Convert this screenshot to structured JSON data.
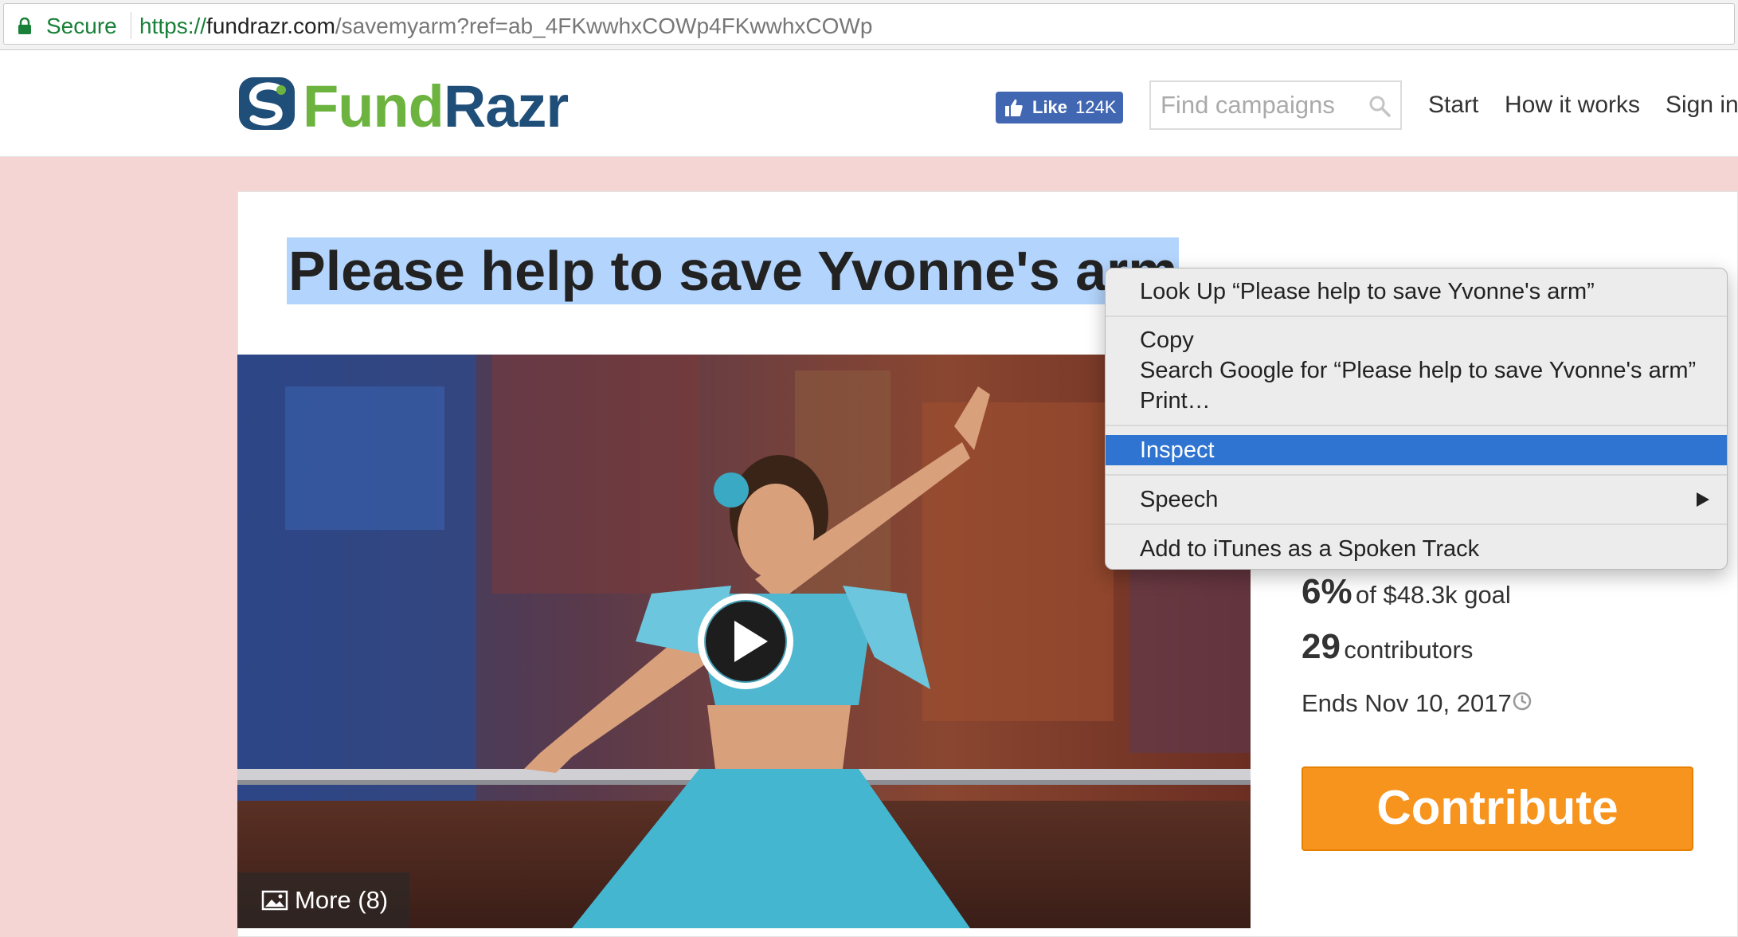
{
  "browser": {
    "secure_label": "Secure",
    "url_scheme": "https://",
    "url_host": "fundrazr.com",
    "url_path": "/savemyarm?ref=ab_4FKwwhxCOWp4FKwwhxCOWp"
  },
  "header": {
    "logo_part1": "Fund",
    "logo_part2": "Razr",
    "fb_like_label": "Like",
    "fb_like_count": "124K",
    "search_placeholder": "Find campaigns",
    "nav": [
      "Start",
      "How it works",
      "Sign in"
    ]
  },
  "campaign": {
    "title": "Please help to save Yvonne's arm",
    "more_photos": "More (8)",
    "percent": "6%",
    "goal_text": "of $48.3k goal",
    "contributors_count": "29",
    "contributors_label": "contributors",
    "ends": "Ends Nov 10, 2017",
    "contribute_label": "Contribute"
  },
  "context_menu": {
    "look_up": "Look Up “Please help to save Yvonne's arm”",
    "copy": "Copy",
    "search_google": "Search Google for “Please help to save Yvonne's arm”",
    "print": "Print…",
    "inspect": "Inspect",
    "speech": "Speech",
    "add_itunes": "Add to iTunes as a Spoken Track",
    "highlighted": "Inspect"
  },
  "colors": {
    "brand_green": "#6cb33f",
    "brand_blue": "#1f4e79",
    "accent_orange": "#f7941d",
    "page_bg": "#f5d4d4",
    "menu_highlight": "#2f74d0",
    "selection": "#b3d4fc"
  }
}
